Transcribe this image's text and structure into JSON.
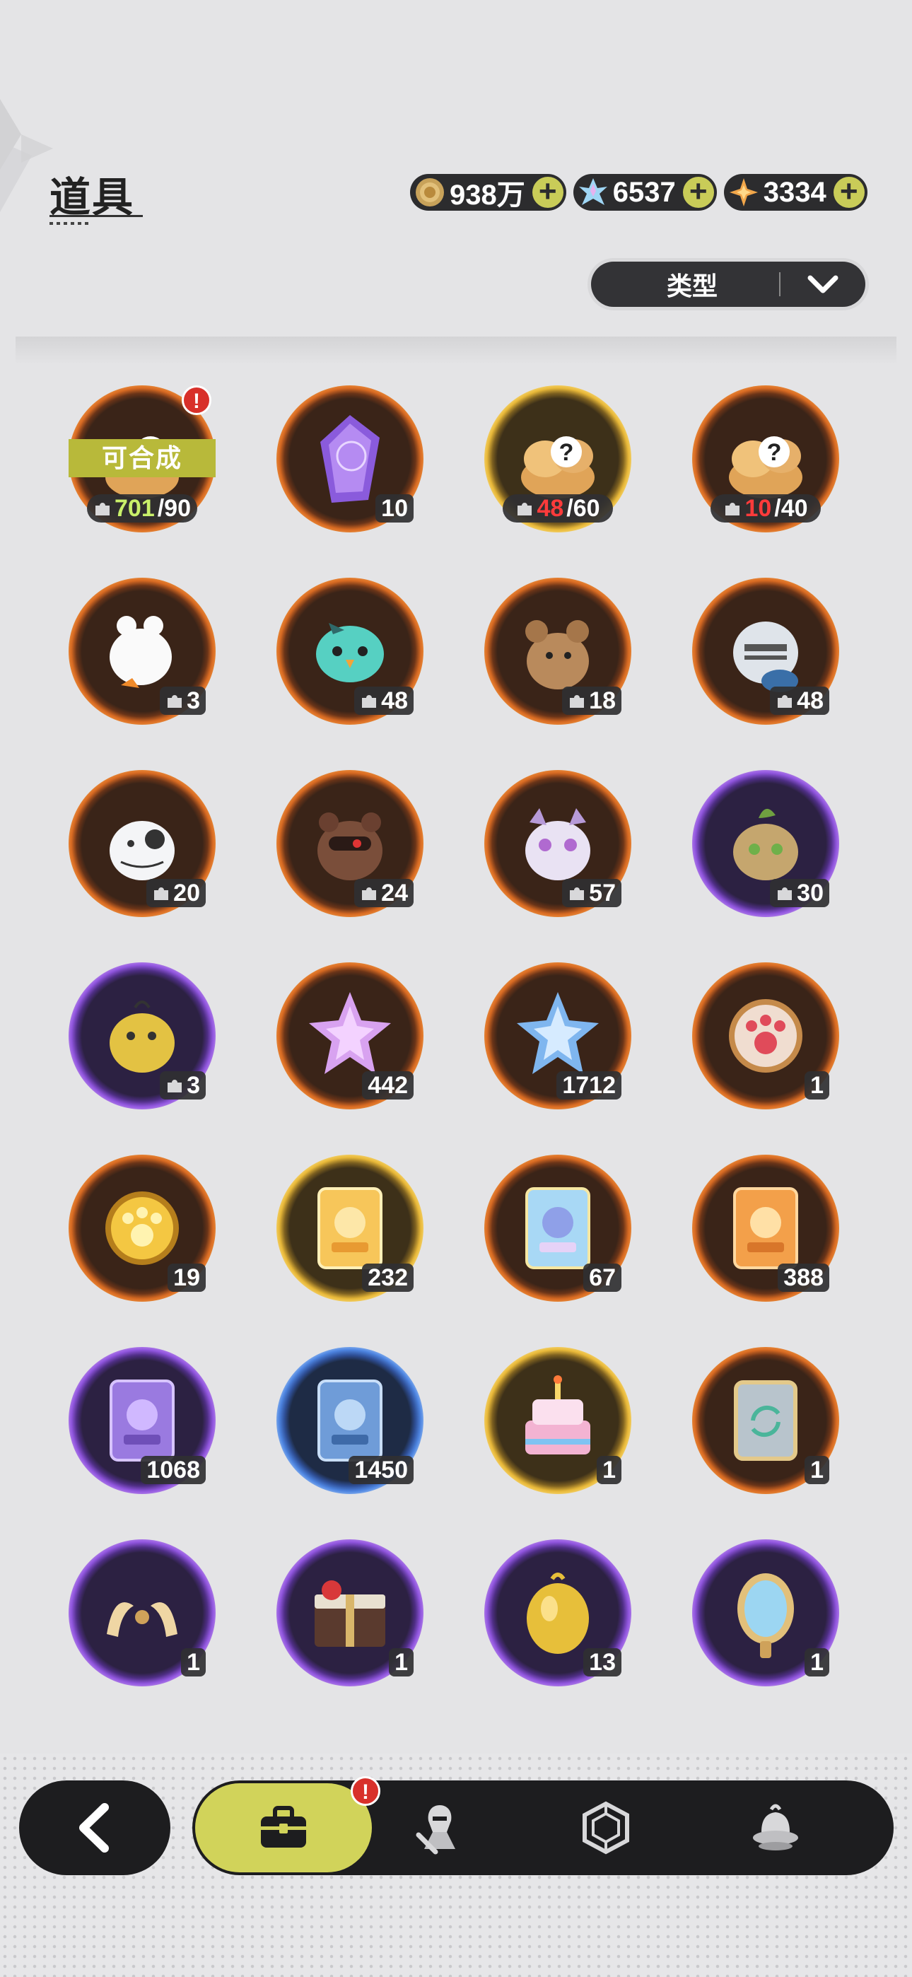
{
  "header": {
    "title": "道具"
  },
  "currencies": [
    {
      "icon": "gold-coin-icon",
      "value": "938万"
    },
    {
      "icon": "crystal-icon",
      "value": "6537"
    },
    {
      "icon": "star-shard-icon",
      "value": "3334"
    }
  ],
  "filter": {
    "label": "类型"
  },
  "craftable_label": "可合成",
  "items": [
    {
      "name": "mystery-fragment-orange-craftable",
      "ring": "orange",
      "icon": "fragment-pile-icon",
      "owned": "701",
      "need": "/90",
      "owned_color": "green"
    },
    {
      "name": "purple-crystal-card",
      "ring": "orange",
      "icon": "purple-crystal-icon",
      "count": "10"
    },
    {
      "name": "mystery-fragment-gold",
      "ring": "gold",
      "icon": "fragment-pile-icon",
      "owned": "48",
      "need": "/60",
      "owned_color": "red"
    },
    {
      "name": "mystery-fragment-orange",
      "ring": "orange",
      "icon": "fragment-pile-icon",
      "owned": "10",
      "need": "/40",
      "owned_color": "red"
    },
    {
      "name": "white-chick-fragment",
      "ring": "orange",
      "icon": "white-chick-icon",
      "count": "3"
    },
    {
      "name": "teal-bird-fragment",
      "ring": "orange",
      "icon": "teal-bird-icon",
      "count": "48"
    },
    {
      "name": "brown-bear-fragment",
      "ring": "orange",
      "icon": "brown-bear-icon",
      "count": "18"
    },
    {
      "name": "knight-helmet-fragment",
      "ring": "orange",
      "icon": "knight-helmet-icon",
      "count": "48"
    },
    {
      "name": "white-cat-fragment",
      "ring": "orange",
      "icon": "white-cat-icon",
      "count": "20"
    },
    {
      "name": "dark-bear-fragment",
      "ring": "orange",
      "icon": "dark-bear-icon",
      "count": "24"
    },
    {
      "name": "lilac-cat-fragment",
      "ring": "orange",
      "icon": "lilac-cat-icon",
      "count": "57"
    },
    {
      "name": "leaf-cat-fragment",
      "ring": "purple",
      "icon": "leaf-cat-icon",
      "count": "30"
    },
    {
      "name": "yellow-chick-fragment",
      "ring": "purple",
      "icon": "yellow-chick-icon",
      "count": "3"
    },
    {
      "name": "pink-star-crystal",
      "ring": "orange",
      "icon": "pink-crystal-icon",
      "count": "442"
    },
    {
      "name": "blue-star-crystal",
      "ring": "orange",
      "icon": "blue-crystal-icon",
      "count": "1712"
    },
    {
      "name": "red-paw-compass",
      "ring": "orange",
      "icon": "paw-compass-icon",
      "count": "1"
    },
    {
      "name": "gold-paw-compass",
      "ring": "orange",
      "icon": "gold-paw-compass-icon",
      "count": "19"
    },
    {
      "name": "gold-character-card",
      "ring": "gold",
      "icon": "gold-card-icon",
      "count": "232"
    },
    {
      "name": "holo-character-card",
      "ring": "orange",
      "icon": "holo-card-icon",
      "count": "67"
    },
    {
      "name": "orange-character-card",
      "ring": "orange",
      "icon": "orange-card-icon",
      "count": "388"
    },
    {
      "name": "purple-character-card",
      "ring": "purple",
      "icon": "purple-card-icon",
      "count": "1068"
    },
    {
      "name": "blue-character-card",
      "ring": "blue",
      "icon": "blue-card-icon",
      "count": "1450"
    },
    {
      "name": "anniversary-cake",
      "ring": "gold",
      "icon": "cake-icon",
      "count": "1"
    },
    {
      "name": "refresh-card",
      "ring": "orange",
      "icon": "refresh-card-icon",
      "count": "1"
    },
    {
      "name": "golden-horns",
      "ring": "purple",
      "icon": "horns-icon",
      "count": "1"
    },
    {
      "name": "gift-box",
      "ring": "purple",
      "icon": "gift-box-icon",
      "count": "1"
    },
    {
      "name": "golden-egg",
      "ring": "purple",
      "icon": "golden-egg-icon",
      "count": "13"
    },
    {
      "name": "magic-mirror",
      "ring": "purple",
      "icon": "mirror-icon",
      "count": "1"
    }
  ],
  "bottom_nav": {
    "back_icon": "back-arrow-icon",
    "tabs": [
      "briefcase-icon",
      "knight-icon",
      "hexagon-gem-icon",
      "pudding-icon"
    ],
    "active": 0,
    "alert": "!"
  },
  "alert_mark": "!"
}
